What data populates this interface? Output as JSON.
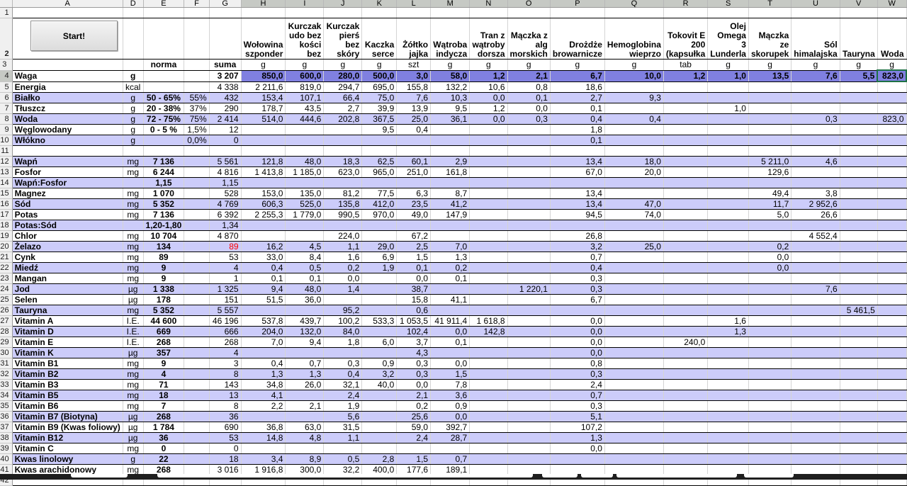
{
  "button": {
    "label": "Start!"
  },
  "columns": [
    "A",
    "D",
    "E",
    "F",
    "G",
    "H",
    "I",
    "J",
    "K",
    "L",
    "M",
    "N",
    "O",
    "P",
    "Q",
    "R",
    "S",
    "T",
    "U",
    "V",
    "W"
  ],
  "header_row2": {
    "H": "Wołowina szponder",
    "I": "Kurczak udo bez kości bez",
    "J": "Kurczak pierś bez skóry",
    "K": "Kaczka serce",
    "L": "Żółtko jajka",
    "M": "Wątroba indycza",
    "N": "Tran z wątroby dorsza",
    "O": "Mączka z alg morskich",
    "P": "Drożdże browarnicze",
    "Q": "Hemoglobina wieprzo",
    "R": "Tokovit E 200 (kapsułka",
    "S": "Olej Omega 3 Lunderla",
    "T": "Mączka ze skorupek",
    "U": "Sól himalajska",
    "V": "Tauryna",
    "W": "Woda"
  },
  "header_row3": {
    "E": "norma",
    "G": "suma",
    "H": "g",
    "I": "g",
    "J": "g",
    "K": "g",
    "L": "szt",
    "M": "g",
    "N": "g",
    "O": "g",
    "P": "g",
    "Q": "g",
    "R": "tab",
    "S": "g",
    "T": "g",
    "U": "g",
    "V": "g",
    "W": "g"
  },
  "rows": [
    {
      "n": 4,
      "A": "Waga",
      "D": "g",
      "G": "3 207",
      "H": "850,0",
      "I": "600,0",
      "J": "280,0",
      "K": "500,0",
      "L": "3,0",
      "M": "58,0",
      "N": "1,2",
      "O": "2,1",
      "P": "6,7",
      "Q": "10,0",
      "R": "1,2",
      "S": "1,0",
      "T": "13,5",
      "U": "7,6",
      "V": "5,5",
      "W": "823,0"
    },
    {
      "n": 5,
      "A": "Energia",
      "D": "kcal",
      "G": "4 338",
      "H": "2 211,6",
      "I": "819,0",
      "J": "294,7",
      "K": "695,0",
      "L": "155,8",
      "M": "132,2",
      "N": "10,6",
      "O": "0,8",
      "P": "18,6"
    },
    {
      "n": 6,
      "A": "Białko",
      "D": "g",
      "E": "50 - 65%",
      "F": "55%",
      "G": "432",
      "H": "153,4",
      "I": "107,1",
      "J": "66,4",
      "K": "75,0",
      "L": "7,6",
      "M": "10,3",
      "N": "0,0",
      "O": "0,1",
      "P": "2,7",
      "Q": "9,3"
    },
    {
      "n": 7,
      "A": "Tłuszcz",
      "D": "g",
      "E": "20 - 38%",
      "F": "37%",
      "G": "290",
      "H": "178,7",
      "I": "43,5",
      "J": "2,7",
      "K": "39,9",
      "L": "13,9",
      "M": "9,5",
      "N": "1,2",
      "O": "0,0",
      "P": "0,1",
      "S": "1,0"
    },
    {
      "n": 8,
      "A": "Woda",
      "D": "g",
      "E": "72 - 75%",
      "F": "75%",
      "G": "2 414",
      "H": "514,0",
      "I": "444,6",
      "J": "202,8",
      "K": "367,5",
      "L": "25,0",
      "M": "36,1",
      "N": "0,0",
      "O": "0,3",
      "P": "0,4",
      "Q": "0,4",
      "U": "0,3",
      "W": "823,0"
    },
    {
      "n": 9,
      "A": "Węglowodany",
      "D": "g",
      "E": "0 - 5 %",
      "F": "1,5%",
      "G": "12",
      "K": "9,5",
      "L": "0,4",
      "P": "1,8"
    },
    {
      "n": 10,
      "A": "Włókno",
      "D": "g",
      "F": "0,0%",
      "G": "0",
      "P": "0,1"
    },
    {
      "n": 11
    },
    {
      "n": 12,
      "A": "Wapń",
      "D": "mg",
      "E": "7 136",
      "G": "5 561",
      "H": "121,8",
      "I": "48,0",
      "J": "18,3",
      "K": "62,5",
      "L": "60,1",
      "M": "2,9",
      "P": "13,4",
      "Q": "18,0",
      "T": "5 211,0",
      "U": "4,6"
    },
    {
      "n": 13,
      "A": "Fosfor",
      "D": "mg",
      "E": "6 244",
      "G": "4 816",
      "H": "1 413,8",
      "I": "1 185,0",
      "J": "623,0",
      "K": "965,0",
      "L": "251,0",
      "M": "161,8",
      "P": "67,0",
      "Q": "20,0",
      "T": "129,6"
    },
    {
      "n": 14,
      "A": "Wapń:Fosfor",
      "E": "1,15",
      "G": "1,15"
    },
    {
      "n": 15,
      "A": "Magnez",
      "D": "mg",
      "E": "1 070",
      "G": "528",
      "H": "153,0",
      "I": "135,0",
      "J": "81,2",
      "K": "77,5",
      "L": "6,3",
      "M": "8,7",
      "P": "13,4",
      "T": "49,4",
      "U": "3,8"
    },
    {
      "n": 16,
      "A": "Sód",
      "D": "mg",
      "E": "5 352",
      "G": "4 769",
      "H": "606,3",
      "I": "525,0",
      "J": "135,8",
      "K": "412,0",
      "L": "23,5",
      "M": "41,2",
      "P": "13,4",
      "Q": "47,0",
      "T": "11,7",
      "U": "2 952,6"
    },
    {
      "n": 17,
      "A": "Potas",
      "D": "mg",
      "E": "7 136",
      "G": "6 392",
      "H": "2 255,3",
      "I": "1 779,0",
      "J": "990,5",
      "K": "970,0",
      "L": "49,0",
      "M": "147,9",
      "P": "94,5",
      "Q": "74,0",
      "T": "5,0",
      "U": "26,6"
    },
    {
      "n": 18,
      "A": "Potas:Sód",
      "E": "1,20-1,80",
      "G": "1,34"
    },
    {
      "n": 19,
      "A": "Chlor",
      "D": "mg",
      "E": "10 704",
      "G": "4 870",
      "J": "224,0",
      "L": "67,2",
      "P": "26,8",
      "U": "4 552,4"
    },
    {
      "n": 20,
      "A": "Żelazo",
      "D": "mg",
      "E": "134",
      "G": "89",
      "H": "16,2",
      "I": "4,5",
      "J": "1,1",
      "K": "29,0",
      "L": "2,5",
      "M": "7,0",
      "P": "3,2",
      "Q": "25,0",
      "T": "0,2"
    },
    {
      "n": 21,
      "A": "Cynk",
      "D": "mg",
      "E": "89",
      "G": "53",
      "H": "33,0",
      "I": "8,4",
      "J": "1,6",
      "K": "6,9",
      "L": "1,5",
      "M": "1,3",
      "P": "0,7",
      "T": "0,0"
    },
    {
      "n": 22,
      "A": "Miedź",
      "D": "mg",
      "E": "9",
      "G": "4",
      "H": "0,4",
      "I": "0,5",
      "J": "0,2",
      "K": "1,9",
      "L": "0,1",
      "M": "0,2",
      "P": "0,4",
      "T": "0,0"
    },
    {
      "n": 23,
      "A": "Mangan",
      "D": "mg",
      "E": "9",
      "G": "1",
      "H": "0,1",
      "I": "0,1",
      "J": "0,0",
      "L": "0,0",
      "M": "0,1",
      "P": "0,3"
    },
    {
      "n": 24,
      "A": "Jod",
      "D": "µg",
      "E": "1 338",
      "G": "1 325",
      "H": "9,4",
      "I": "48,0",
      "J": "1,4",
      "L": "38,7",
      "O": "1 220,1",
      "P": "0,3",
      "U": "7,6"
    },
    {
      "n": 25,
      "A": "Selen",
      "D": "µg",
      "E": "178",
      "G": "151",
      "H": "51,5",
      "I": "36,0",
      "L": "15,8",
      "M": "41,1",
      "P": "6,7"
    },
    {
      "n": 26,
      "A": "Tauryna",
      "D": "mg",
      "E": "5 352",
      "G": "5 557",
      "J": "95,2",
      "L": "0,6",
      "V": "5 461,5"
    },
    {
      "n": 27,
      "A": "Vitamin A",
      "D": "I.E.",
      "E": "44 600",
      "G": "46 196",
      "H": "537,8",
      "I": "439,7",
      "J": "100,2",
      "K": "533,3",
      "L": "1 053,5",
      "M": "41 911,4",
      "N": "1 618,8",
      "P": "0,0",
      "S": "1,6"
    },
    {
      "n": 28,
      "A": "Vitamin D",
      "D": "I.E.",
      "E": "669",
      "G": "666",
      "H": "204,0",
      "I": "132,0",
      "J": "84,0",
      "L": "102,4",
      "M": "0,0",
      "N": "142,8",
      "P": "0,0",
      "S": "1,3"
    },
    {
      "n": 29,
      "A": "Vitamin E",
      "D": "I.E.",
      "E": "268",
      "G": "268",
      "H": "7,0",
      "I": "9,4",
      "J": "1,8",
      "K": "6,0",
      "L": "3,7",
      "M": "0,1",
      "P": "0,0",
      "R": "240,0"
    },
    {
      "n": 30,
      "A": "Vitamin K",
      "D": "µg",
      "E": "357",
      "G": "4",
      "L": "4,3",
      "P": "0,0"
    },
    {
      "n": 31,
      "A": "Vitamin B1",
      "D": "mg",
      "E": "9",
      "G": "3",
      "H": "0,4",
      "I": "0,7",
      "J": "0,3",
      "K": "0,9",
      "L": "0,3",
      "M": "0,0",
      "P": "0,8"
    },
    {
      "n": 32,
      "A": "Vitamin B2",
      "D": "mg",
      "E": "4",
      "G": "8",
      "H": "1,3",
      "I": "1,3",
      "J": "0,4",
      "K": "3,2",
      "L": "0,3",
      "M": "1,5",
      "P": "0,3"
    },
    {
      "n": 33,
      "A": "Vitamin B3",
      "D": "mg",
      "E": "71",
      "G": "143",
      "H": "34,8",
      "I": "26,0",
      "J": "32,1",
      "K": "40,0",
      "L": "0,0",
      "M": "7,8",
      "P": "2,4"
    },
    {
      "n": 34,
      "A": "Vitamin B5",
      "D": "mg",
      "E": "18",
      "G": "13",
      "H": "4,1",
      "J": "2,4",
      "L": "2,1",
      "M": "3,6",
      "P": "0,7"
    },
    {
      "n": 35,
      "A": "Vitamin B6",
      "D": "mg",
      "E": "7",
      "G": "8",
      "H": "2,2",
      "I": "2,1",
      "J": "1,9",
      "L": "0,2",
      "M": "0,9",
      "P": "0,3"
    },
    {
      "n": 36,
      "A": "Vitamin B7 (Biotyna)",
      "D": "µg",
      "E": "268",
      "G": "36",
      "J": "5,6",
      "L": "25,6",
      "M": "0,0",
      "P": "5,1"
    },
    {
      "n": 37,
      "A": "Vitamin B9 (Kwas foliowy)",
      "D": "µg",
      "E": "1 784",
      "G": "690",
      "H": "36,8",
      "I": "63,0",
      "J": "31,5",
      "L": "59,0",
      "M": "392,7",
      "P": "107,2"
    },
    {
      "n": 38,
      "A": "Vitamin B12",
      "D": "µg",
      "E": "36",
      "G": "53",
      "H": "14,8",
      "I": "4,8",
      "J": "1,1",
      "L": "2,4",
      "M": "28,7",
      "P": "1,3"
    },
    {
      "n": 39,
      "A": "Vitamin C",
      "D": "mg",
      "E": "0",
      "G": "0",
      "P": "0,0"
    },
    {
      "n": 40,
      "A": "Kwas linolowy",
      "D": "g",
      "E": "22",
      "G": "18",
      "H": "3,4",
      "I": "8,9",
      "J": "0,5",
      "K": "2,8",
      "L": "1,5",
      "M": "0,7"
    },
    {
      "n": 41,
      "A": "Kwas arachidonowy",
      "D": "mg",
      "E": "268",
      "G": "3 016",
      "H": "1 916,8",
      "I": "300,0",
      "J": "32,2",
      "K": "400,0",
      "L": "177,6",
      "M": "189,1"
    },
    {
      "n": 42
    }
  ],
  "colors": {
    "band": "#ccccfa",
    "weight_row": "#8080e0",
    "selection_border": "#1e7145",
    "warning_text": "#ff0000"
  }
}
